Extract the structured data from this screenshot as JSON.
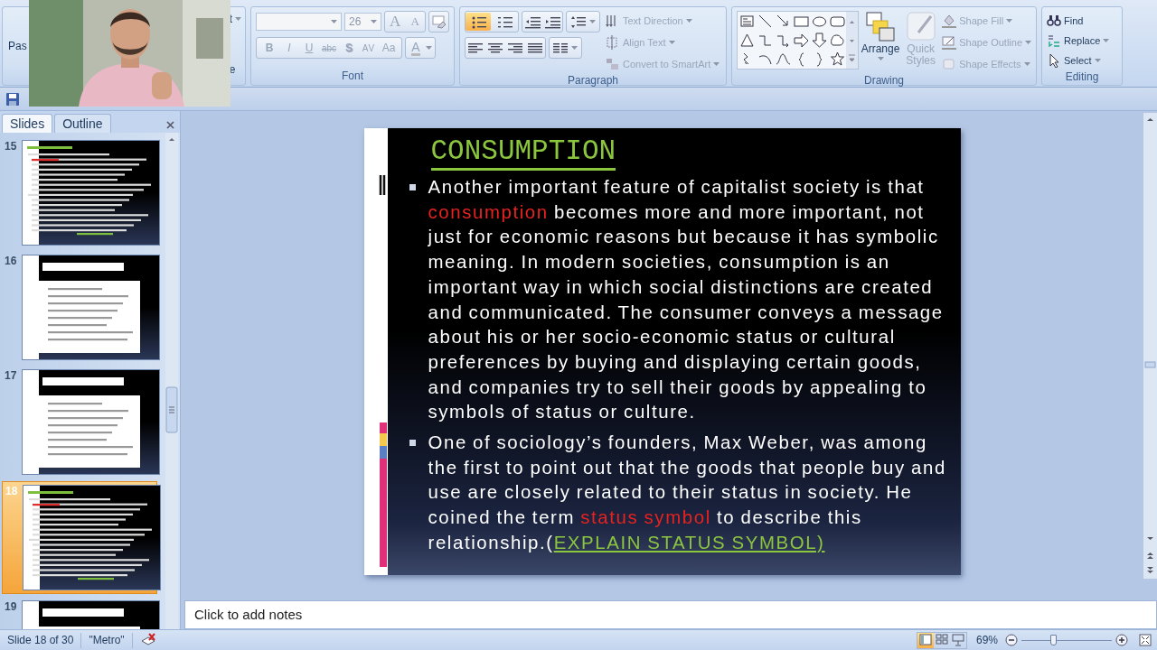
{
  "ribbon": {
    "clipboard": {
      "paste_label": "Pas",
      "fragment_top": "t",
      "fragment_bottom": "e"
    },
    "font": {
      "font_size": "26",
      "grow_label": "A",
      "shrink_label": "A",
      "disabled": true,
      "format_buttons": [
        {
          "kind": "bold",
          "label": "B"
        },
        {
          "kind": "italic",
          "label": "I"
        },
        {
          "kind": "underline",
          "label": "U"
        },
        {
          "kind": "strike",
          "label": "abc"
        },
        {
          "kind": "shadow",
          "label": "S"
        },
        {
          "kind": "spacing",
          "label": "AV"
        },
        {
          "kind": "case",
          "label": "Aa"
        }
      ],
      "color_label": "A",
      "label": "Font"
    },
    "paragraph": {
      "list_buttons": [
        {
          "kind": "bullets",
          "selected": true
        },
        {
          "kind": "numbering",
          "selected": false
        }
      ],
      "commands": [
        {
          "kind": "direction",
          "label": "Text Direction",
          "disabled": true
        },
        {
          "kind": "align",
          "label": "Align Text",
          "disabled": true
        },
        {
          "kind": "smartart",
          "label": "Convert to SmartArt",
          "disabled": true
        }
      ],
      "label": "Paragraph"
    },
    "drawing": {
      "arrange": "Arrange",
      "quick_styles": {
        "label": "Quick Styles",
        "disabled": true
      },
      "commands": [
        {
          "kind": "fill",
          "label": "Shape Fill",
          "disabled": true
        },
        {
          "kind": "outline",
          "label": "Shape Outline",
          "disabled": true
        },
        {
          "kind": "effects",
          "label": "Shape Effects",
          "disabled": true
        }
      ],
      "label": "Drawing"
    },
    "editing": {
      "commands": [
        {
          "kind": "find",
          "label": "Find",
          "has_menu": false
        },
        {
          "kind": "replace",
          "label": "Replace",
          "has_menu": true
        },
        {
          "kind": "select",
          "label": "Select",
          "has_menu": true
        }
      ],
      "label": "Editing"
    }
  },
  "panel": {
    "tabs": [
      {
        "label": "Slides",
        "selected": true
      },
      {
        "label": "Outline",
        "selected": false
      }
    ],
    "thumbnails": [
      {
        "number": "15",
        "selected": false,
        "kind": "text"
      },
      {
        "number": "16",
        "selected": false,
        "kind": "card"
      },
      {
        "number": "17",
        "selected": false,
        "kind": "card"
      },
      {
        "number": "18",
        "selected": true,
        "kind": "text"
      },
      {
        "number": "19",
        "selected": false,
        "kind": "card"
      }
    ]
  },
  "slide": {
    "title": "CONSUMPTION",
    "bullets": [
      {
        "runs": [
          {
            "kind": "plain",
            "text": "Another important feature of capitalist society is that "
          },
          {
            "kind": "highlight",
            "text": "consumption"
          },
          {
            "kind": "plain",
            "text": " becomes more and more important, not just for economic reasons but because it has symbolic meaning. In modern societies, consumption is an important way in which social distinctions are created and communicated. The consumer conveys a message about his or her socio-economic status or cultural preferences by buying and displaying certain goods, and companies try to sell their goods by appealing to symbols of status or culture."
          }
        ]
      },
      {
        "runs": [
          {
            "kind": "plain",
            "text": "One of sociology’s founders, Max Weber, was among the first to point out that the goods that people buy and use are closely related to their status in society. He coined the term "
          },
          {
            "kind": "highlight",
            "text": "status symbol"
          },
          {
            "kind": "plain",
            "text": " to describe this relationship.("
          },
          {
            "kind": "link",
            "text": "EXPLAIN STATUS SYMBOL)"
          }
        ]
      }
    ]
  },
  "notes": {
    "prompt": "Click to add notes"
  },
  "status_bar": {
    "slide_info": "Slide 18 of 30",
    "theme": "\"Metro\"",
    "views": [
      {
        "kind": "normal",
        "selected": true
      },
      {
        "kind": "sorter",
        "selected": false
      },
      {
        "kind": "show",
        "selected": false
      }
    ],
    "zoom": "69%",
    "level": 0.35
  }
}
